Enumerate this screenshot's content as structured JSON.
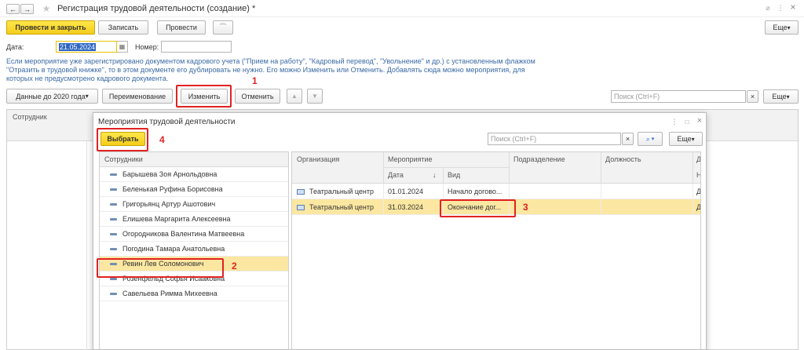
{
  "window": {
    "back": "←",
    "forward": "→",
    "star": "★",
    "title": "Регистрация трудовой деятельности (создание) *",
    "link_icon": "⌀",
    "menu_icon": "⋮",
    "close_icon": "×"
  },
  "toolbar": {
    "post_close": "Провести и закрыть",
    "save": "Записать",
    "post": "Провести",
    "attach_icon": "📎",
    "more": "Еще"
  },
  "form": {
    "date_label": "Дата:",
    "date_value": "21.05.2024",
    "number_label": "Номер:",
    "number_value": ""
  },
  "info_text": [
    "Если мероприятие уже зарегистрировано документом кадрового учета (\"Прием на работу\", \"Кадровый перевод\", \"Увольнение\" и др.) с установленным флажком",
    "\"Отразить в трудовой книжке\", то в этом документе его дублировать не нужно. Его можно Изменить или Отменить. Добавлять сюда можно мероприятия, для",
    "которых не предусмотрено кадрового документа."
  ],
  "toolbar2": {
    "data_before_2020": "Данные до 2020 года",
    "rename": "Переименование",
    "change": "Изменить",
    "cancel": "Отменить",
    "up_icon": "▲",
    "down_icon": "▼",
    "search_placeholder": "Поиск (Ctrl+F)",
    "clear": "×",
    "more": "Еще"
  },
  "main_grid": {
    "col_employee": "Сотрудник"
  },
  "dialog": {
    "title": "Мероприятия трудовой деятельности",
    "menu_icon": "⋮",
    "max_icon": "□",
    "close_icon": "×",
    "select": "Выбрать",
    "search_placeholder": "Поиск (Ctrl+F)",
    "clear": "×",
    "search_icon": "🔍",
    "more": "Еще",
    "employees_header": "Сотрудники",
    "employees": [
      "Барышева Зоя Арнольдовна",
      "Беленькая Руфина Борисовна",
      "Григорьянц Артур Ашотович",
      "Елишева Маргарита Алексеевна",
      "Огородникова Валентина Матвеевна",
      "Погодина Тамара Анатольевна",
      "Ревин Лев Соломонович",
      "Розенфельд Софья Исааковна",
      "Савельева Римма Михеевна"
    ],
    "selected_employee_index": 6,
    "events_columns": {
      "org": "Организация",
      "event": "Мероприятие",
      "date": "Дата",
      "sort_icon": "↓",
      "kind": "Вид",
      "dept": "Подразделение",
      "position": "Должность",
      "extra": "Д",
      "extra2": "Н"
    },
    "events": [
      {
        "org": "Театральный центр",
        "date": "01.01.2024",
        "kind": "Начало догово...",
        "extra": "Д"
      },
      {
        "org": "Театральный центр",
        "date": "31.03.2024",
        "kind": "Окончание дог...",
        "extra": "Д"
      }
    ],
    "selected_event_index": 1
  },
  "annotations": [
    "1",
    "2",
    "3",
    "4"
  ],
  "colors": {
    "accent_yellow": "#f5cd1a",
    "selection": "#fbe7a1",
    "highlight_red": "#e22222",
    "info_text": "#3b6aa5"
  }
}
